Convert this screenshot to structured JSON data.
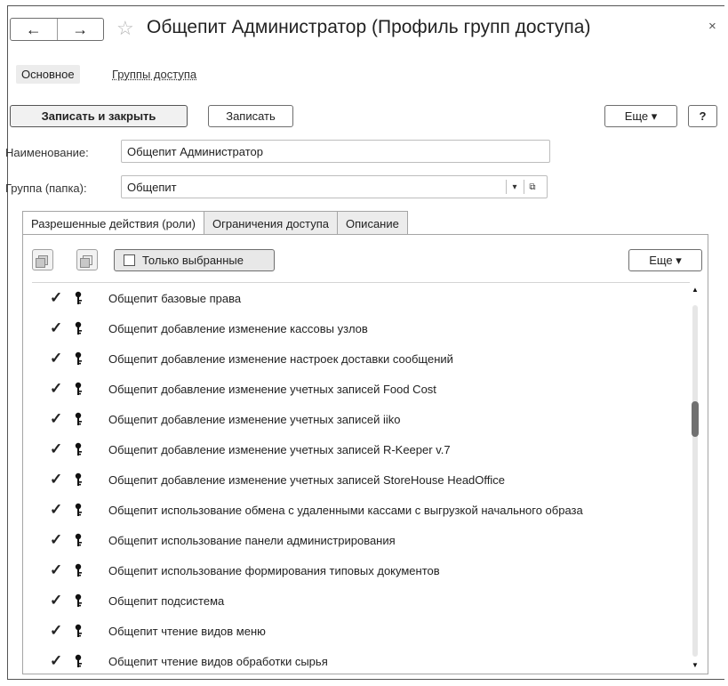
{
  "window": {
    "title": "Общепит Администратор (Профиль групп доступа)",
    "back_icon": "←",
    "forward_icon": "→",
    "star_icon": "☆",
    "close_icon": "×"
  },
  "main_tabs": [
    "Основное",
    "Группы доступа"
  ],
  "toolbar": {
    "save_close": "Записать и закрыть",
    "save": "Записать",
    "more": "Еще ▾",
    "help": "?"
  },
  "form": {
    "name_label": "Наименование:",
    "name_value": "Общепит Администратор",
    "group_label": "Группа (папка):",
    "group_value": "Общепит",
    "dropdown_icon": "▾",
    "open_icon": "⧉"
  },
  "tabs": [
    "Разрешенные действия (роли)",
    "Ограничения доступа",
    "Описание"
  ],
  "roles_toolbar": {
    "only_selected": "Только выбранные",
    "more": "Еще ▾"
  },
  "roles": [
    {
      "checked": true,
      "name": "Общепит базовые права"
    },
    {
      "checked": true,
      "name": "Общепит добавление изменение кассовы узлов"
    },
    {
      "checked": true,
      "name": "Общепит добавление изменение настроек доставки сообщений"
    },
    {
      "checked": true,
      "name": "Общепит добавление изменение учетных записей Food Cost"
    },
    {
      "checked": true,
      "name": "Общепит добавление изменение учетных записей iiko"
    },
    {
      "checked": true,
      "name": "Общепит добавление изменение учетных записей R-Keeper v.7"
    },
    {
      "checked": true,
      "name": "Общепит добавление изменение учетных записей StoreHouse HeadOffice"
    },
    {
      "checked": true,
      "name": "Общепит использование обмена с удаленными кассами с выгрузкой начального образа"
    },
    {
      "checked": true,
      "name": "Общепит использование панели администрирования"
    },
    {
      "checked": true,
      "name": "Общепит использование формирования типовых документов"
    },
    {
      "checked": true,
      "name": "Общепит подсистема"
    },
    {
      "checked": true,
      "name": "Общепит чтение видов меню"
    },
    {
      "checked": true,
      "name": "Общепит чтение видов обработки сырья"
    }
  ],
  "scrollbar": {
    "up_icon": "▲",
    "down_icon": "▼"
  },
  "colors": {
    "frame": "#555555",
    "tab_inactive": "#ececec",
    "primary_button": "#f1f1f1"
  }
}
